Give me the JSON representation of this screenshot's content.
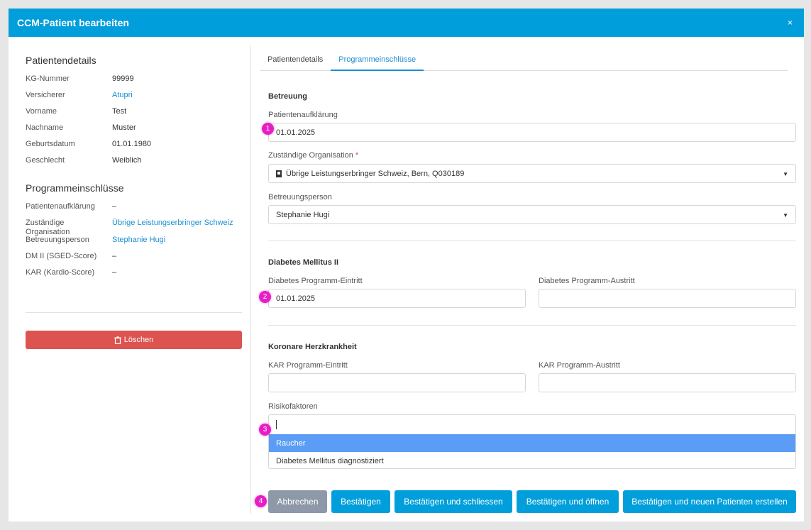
{
  "modal": {
    "title": "CCM-Patient bearbeiten",
    "close_label": "×"
  },
  "left": {
    "patient_details_title": "Patientendetails",
    "patient_details": [
      {
        "key": "KG-Nummer",
        "value": "99999",
        "link": false
      },
      {
        "key": "Versicherer",
        "value": "Atupri",
        "link": true
      },
      {
        "key": "Vorname",
        "value": "Test",
        "link": false
      },
      {
        "key": "Nachname",
        "value": "Muster",
        "link": false
      },
      {
        "key": "Geburtsdatum",
        "value": "01.01.1980",
        "link": false
      },
      {
        "key": "Geschlecht",
        "value": "Weiblich",
        "link": false
      }
    ],
    "programs_title": "Programmeinschlüsse",
    "programs": [
      {
        "key": "Patientenaufklärung",
        "value": "–",
        "link": false
      },
      {
        "key": "Zuständige Organisation",
        "value": "Übrige Leistungserbringer Schweiz",
        "link": true
      },
      {
        "key": "Betreuungsperson",
        "value": "Stephanie Hugi",
        "link": true
      },
      {
        "key": "DM II (SGED-Score)",
        "value": "–",
        "link": false
      },
      {
        "key": "KAR (Kardio-Score)",
        "value": "–",
        "link": false
      }
    ],
    "delete_label": "Löschen"
  },
  "tabs": [
    {
      "label": "Patientendetails",
      "active": false
    },
    {
      "label": "Programmeinschlüsse",
      "active": true
    }
  ],
  "form": {
    "betreuung_title": "Betreuung",
    "aufklaerung_label": "Patientenaufklärung",
    "aufklaerung_value": "01.01.2025",
    "org_label": "Zuständige Organisation",
    "org_required": "*",
    "org_value": "Übrige Leistungserbringer Schweiz, Bern, Q030189",
    "person_label": "Betreuungsperson",
    "person_value": "Stephanie Hugi",
    "diabetes_title": "Diabetes Mellitus II",
    "dm_entry_label": "Diabetes Programm-Eintritt",
    "dm_entry_value": "01.01.2025",
    "dm_exit_label": "Diabetes Programm-Austritt",
    "dm_exit_value": "",
    "kar_title": "Koronare Herzkrankheit",
    "kar_entry_label": "KAR Programm-Eintritt",
    "kar_entry_value": "",
    "kar_exit_label": "KAR Programm-Austritt",
    "kar_exit_value": "",
    "risk_label": "Risikofaktoren",
    "risk_options": [
      "Raucher",
      "Diabetes Mellitus diagnostiziert"
    ]
  },
  "markers": [
    "1",
    "2",
    "3",
    "4"
  ],
  "buttons": {
    "cancel": "Abbrechen",
    "confirm": "Bestätigen",
    "confirm_close": "Bestätigen und schliessen",
    "confirm_open": "Bestätigen und öffnen",
    "confirm_new": "Bestätigen und neuen Patienten erstellen"
  },
  "colors": {
    "header": "#009fdb",
    "danger": "#dc5350",
    "link": "#1a8fd0",
    "marker": "#e71ec5",
    "secondary": "#8d98a8",
    "highlight": "#5b9cf6"
  }
}
